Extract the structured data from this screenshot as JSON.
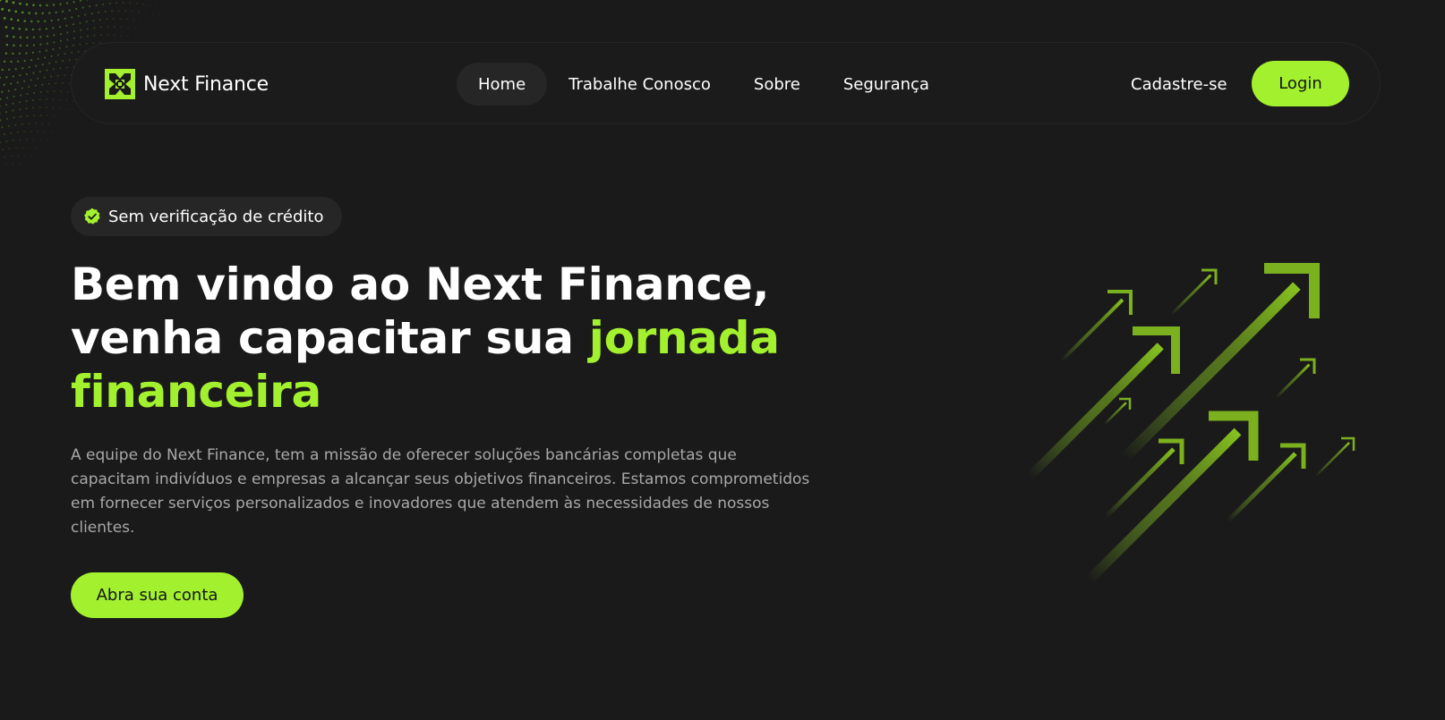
{
  "brand": {
    "name": "Next Finance",
    "accent_color": "#a3f12e",
    "logo_icon": "next-finance-logo-icon"
  },
  "nav": {
    "links": [
      {
        "label": "Home",
        "active": true
      },
      {
        "label": "Trabalhe Conosco",
        "active": false
      },
      {
        "label": "Sobre",
        "active": false
      },
      {
        "label": "Segurança",
        "active": false
      }
    ],
    "signup_label": "Cadastre-se",
    "login_label": "Login"
  },
  "hero": {
    "badge": {
      "icon": "check-badge-icon",
      "text": "Sem verificação de crédito"
    },
    "headline_line1": "Bem vindo ao Next Finance,",
    "headline_line2_plain": "venha capacitar sua ",
    "headline_line2_accent": "jornada",
    "headline_line3_accent": "financeira",
    "description": "A equipe do Next Finance, tem a missão de oferecer soluções bancárias completas que capacitam indivíduos e empresas a alcançar seus objetivos financeiros. Estamos comprometidos em fornecer serviços personalizados e inovadores que atendem às necessidades de nossos clientes.",
    "cta_label": "Abra sua conta",
    "illustration_icon": "growth-arrows-icon"
  },
  "colors": {
    "background": "#1a1a1a",
    "surface": "#262626",
    "accent": "#a3f12e",
    "text_muted": "#a8a8a8"
  }
}
